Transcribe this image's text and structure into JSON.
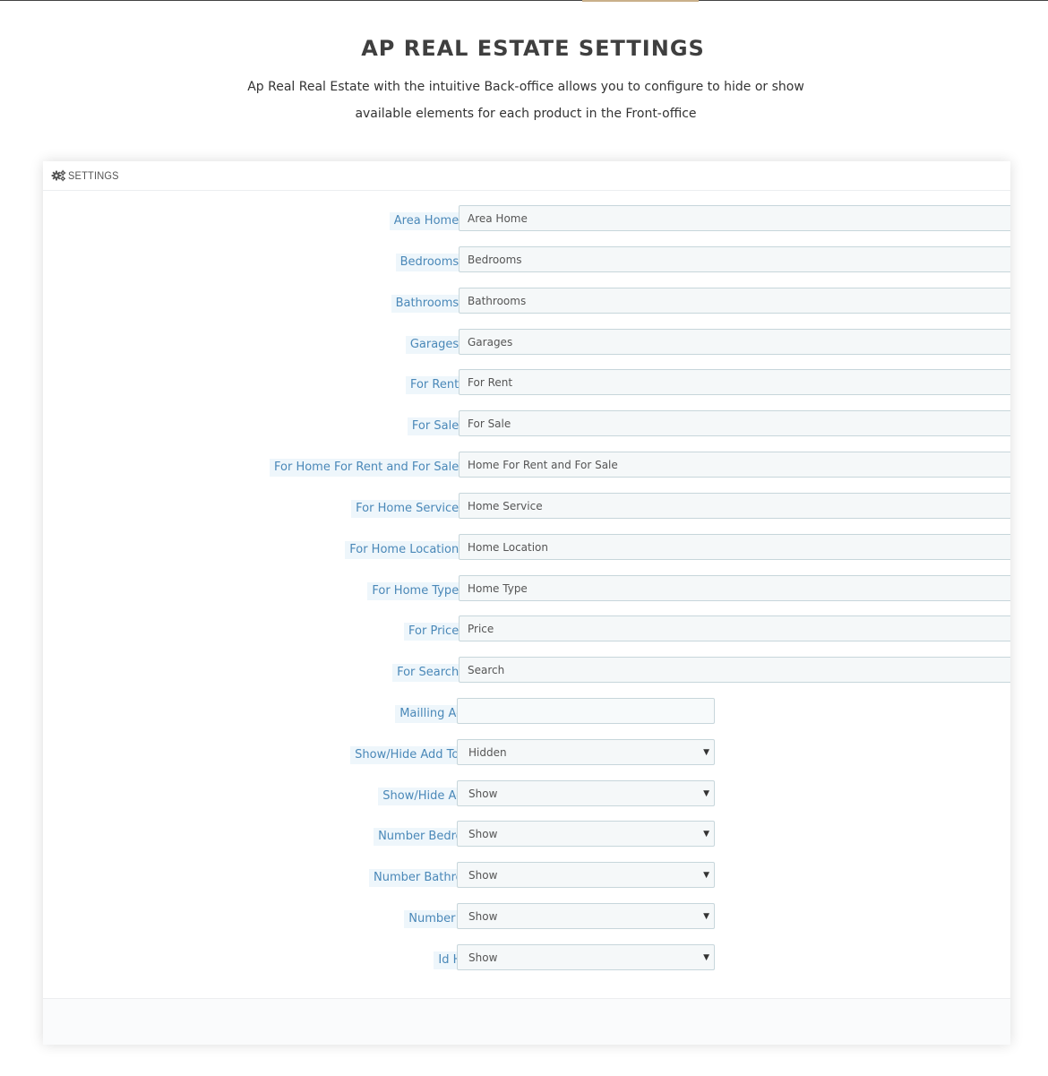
{
  "page": {
    "title": "AP REAL ESTATE SETTINGS",
    "subtitle_line1": "Ap Real Real Estate with the intuitive Back-office allows you to configure to hide or show",
    "subtitle_line2": "available elements for each product in the Front-office"
  },
  "panel": {
    "title": "SETTINGS",
    "icon": "gears-icon"
  },
  "text_fields": [
    {
      "label": "Area Home Text:",
      "value": "Area Home"
    },
    {
      "label": "Bedrooms Text:",
      "value": "Bedrooms"
    },
    {
      "label": "Bathrooms Text:",
      "value": "Bathrooms"
    },
    {
      "label": "Garages Text:",
      "value": "Garages"
    },
    {
      "label": "For Rent Text:",
      "value": "For Rent"
    },
    {
      "label": "For Sale Text:",
      "value": "For Sale"
    },
    {
      "label": "For Home For Rent and For Sale Text:",
      "value": "Home For Rent and For Sale"
    },
    {
      "label": "For Home Service Text:",
      "value": "Home Service"
    },
    {
      "label": "For Home Location Text:",
      "value": "Home Location"
    },
    {
      "label": "For Home Type Text:",
      "value": "Home Type"
    },
    {
      "label": "For Price Text:",
      "value": "Price"
    },
    {
      "label": "For Search Text:",
      "value": "Search"
    }
  ],
  "mailing": {
    "label": "Mailling Adress",
    "value": ""
  },
  "selects": [
    {
      "label": "Show/Hide Add To Cart",
      "value": "Hidden"
    },
    {
      "label": "Show/Hide Adress",
      "value": "Show"
    },
    {
      "label": "Number Bedrooms",
      "value": "Show"
    },
    {
      "label": "Number Bathrooms",
      "value": "Show"
    },
    {
      "label": "Number Gara",
      "value": "Show"
    },
    {
      "label": "Id Home",
      "value": "Show"
    }
  ],
  "colors": {
    "label_text": "#4a88b8",
    "label_bg": "#eef6fb",
    "title": "#3f3f3f"
  }
}
